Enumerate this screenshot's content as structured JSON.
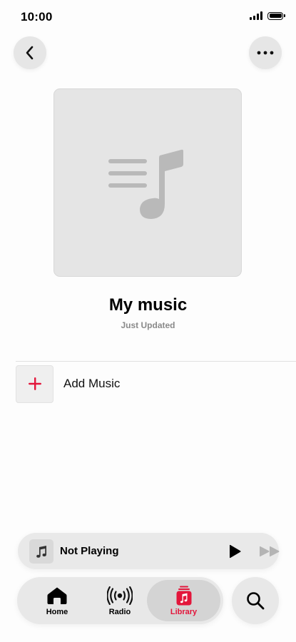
{
  "status_bar": {
    "time": "10:00"
  },
  "header": {
    "back_icon": "chevron-left-icon",
    "more_icon": "ellipsis-icon"
  },
  "playlist": {
    "artwork_icon": "music-list-icon",
    "title": "My music",
    "subtitle": "Just Updated"
  },
  "add_music": {
    "icon": "plus-icon",
    "label": "Add Music"
  },
  "mini_player": {
    "title": "Not Playing",
    "art_icon": "music-note-icon",
    "play_icon": "play-icon",
    "forward_icon": "forward-icon"
  },
  "tabs": [
    {
      "label": "Home",
      "icon": "house-icon",
      "selected": false
    },
    {
      "label": "Radio",
      "icon": "radio-waves-icon",
      "selected": false
    },
    {
      "label": "Library",
      "icon": "library-icon",
      "selected": true
    }
  ],
  "search_icon": "search-icon",
  "colors": {
    "accent": "#e3163b",
    "background": "#fdfdfd",
    "control_background": "#e8e8e8",
    "secondary_text": "#8a8a8a"
  }
}
